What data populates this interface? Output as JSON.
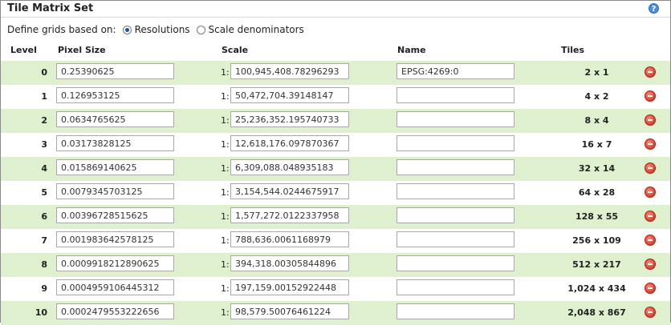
{
  "panel": {
    "title": "Tile Matrix Set",
    "help_icon": "help-icon",
    "define_label": "Define grids based on:",
    "options": [
      {
        "label": "Resolutions",
        "selected": true
      },
      {
        "label": "Scale denominators",
        "selected": false
      }
    ]
  },
  "table": {
    "headers": {
      "level": "Level",
      "pixel_size": "Pixel Size",
      "scale": "Scale",
      "name": "Name",
      "tiles": "Tiles"
    },
    "scale_prefix": "1:",
    "rows": [
      {
        "level": "0",
        "pixel_size": "0.25390625",
        "scale": "100,945,408.78296293",
        "name": "EPSG:4269:0",
        "tiles": "2 x 1"
      },
      {
        "level": "1",
        "pixel_size": "0.126953125",
        "scale": "50,472,704.39148147",
        "name": "",
        "tiles": "4 x 2"
      },
      {
        "level": "2",
        "pixel_size": "0.0634765625",
        "scale": "25,236,352.195740733",
        "name": "",
        "tiles": "8 x 4"
      },
      {
        "level": "3",
        "pixel_size": "0.03173828125",
        "scale": "12,618,176.097870367",
        "name": "",
        "tiles": "16 x 7"
      },
      {
        "level": "4",
        "pixel_size": "0.015869140625",
        "scale": "6,309,088.048935183",
        "name": "",
        "tiles": "32 x 14"
      },
      {
        "level": "5",
        "pixel_size": "0.0079345703125",
        "scale": "3,154,544.0244675917",
        "name": "",
        "tiles": "64 x 28"
      },
      {
        "level": "6",
        "pixel_size": "0.00396728515625",
        "scale": "1,577,272.0122337958",
        "name": "",
        "tiles": "128 x 55"
      },
      {
        "level": "7",
        "pixel_size": "0.001983642578125",
        "scale": "788,636.0061168979",
        "name": "",
        "tiles": "256 x 109"
      },
      {
        "level": "8",
        "pixel_size": "0.0009918212890625",
        "scale": "394,318.00305844896",
        "name": "",
        "tiles": "512 x 217"
      },
      {
        "level": "9",
        "pixel_size": "0.0004959106445312",
        "scale": "197,159.00152922448",
        "name": "",
        "tiles": "1,024 x 434"
      },
      {
        "level": "10",
        "pixel_size": "0.0002479553222656",
        "scale": "98,579.50076461224",
        "name": "",
        "tiles": "2,048 x 867"
      }
    ]
  },
  "colors": {
    "row_alt": "#dff0cf",
    "delete_button": "#e0503c"
  }
}
